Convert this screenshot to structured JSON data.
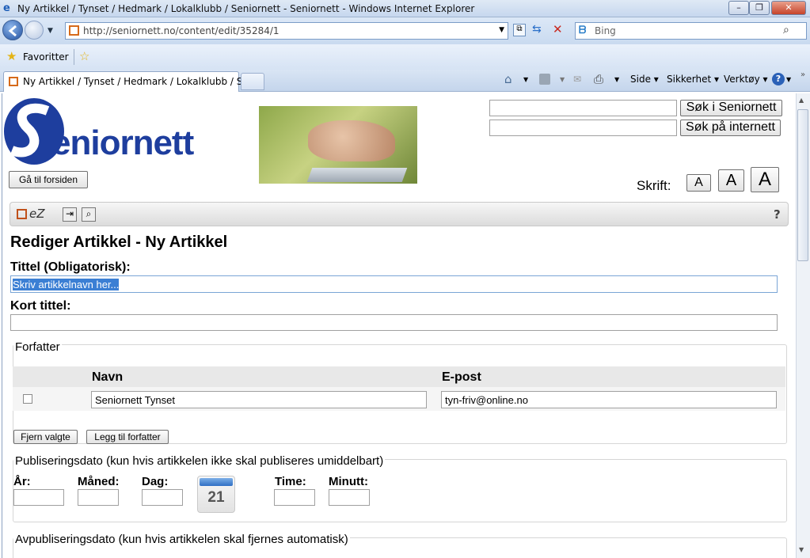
{
  "window": {
    "title": "Ny Artikkel / Tynset / Hedmark / Lokalklubb / Seniornett - Seniornett - Windows Internet Explorer",
    "minimize": "–",
    "maximize": "❐",
    "close": "✕"
  },
  "browser": {
    "url": "http://seniornett.no/content/edit/35284/1",
    "search_placeholder": "Bing",
    "favorites_label": "Favoritter",
    "tab_title": "Ny Artikkel / Tynset / Hedmark / Lokalklubb / Se...",
    "commands": [
      "Side",
      "Sikkerhet",
      "Verktøy"
    ]
  },
  "site": {
    "logo_text": "Seniornett",
    "home_button": "Gå til forsiden",
    "search_site_button": "Søk i Seniornett",
    "search_web_button": "Søk på internett",
    "font_label": "Skrift:",
    "font_sizes": [
      "A",
      "A",
      "A"
    ],
    "ez_label": "eZ",
    "help": "?"
  },
  "form": {
    "heading": "Rediger Artikkel - Ny Artikkel",
    "title_label": "Tittel (Obligatorisk):",
    "title_value": "Skriv artikkelnavn her...",
    "short_title_label": "Kort tittel:",
    "short_title_value": "",
    "author": {
      "legend": "Forfatter",
      "col_name": "Navn",
      "col_email": "E-post",
      "name_value": "Seniornett Tynset",
      "email_value": "tyn-friv@online.no",
      "remove_button": "Fjern valgte",
      "add_button": "Legg til forfatter"
    },
    "publish": {
      "legend": "Publiseringsdato (kun hvis artikkelen ikke skal publiseres umiddelbart)",
      "year": "År:",
      "month": "Måned:",
      "day": "Dag:",
      "hour": "Time:",
      "minute": "Minutt:",
      "calendar_day": "21"
    },
    "unpublish": {
      "legend": "Avpubliseringsdato (kun hvis artikkelen skal fjernes automatisk)"
    }
  }
}
